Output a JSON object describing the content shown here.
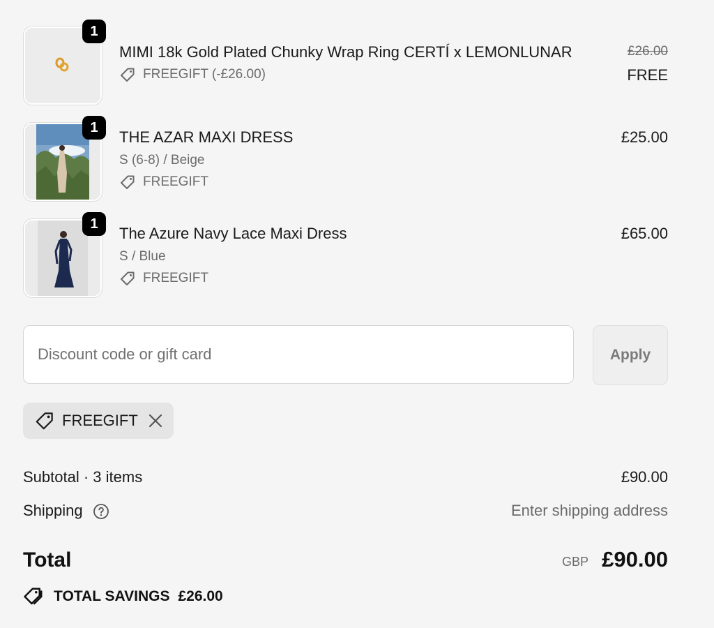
{
  "items": [
    {
      "quantity": "1",
      "title": "MIMI 18k Gold Plated Chunky Wrap Ring CERTÍ x LEMONLUNAR",
      "discount": "FREEGIFT (-£26.00)",
      "original_price": "£26.00",
      "price": "FREE"
    },
    {
      "quantity": "1",
      "title": "THE AZAR MAXI DRESS",
      "variant": "S (6-8) / Beige",
      "discount": "FREEGIFT",
      "price": "£25.00"
    },
    {
      "quantity": "1",
      "title": "The Azure Navy Lace Maxi Dress",
      "variant": "S / Blue",
      "discount": "FREEGIFT",
      "price": "£65.00"
    }
  ],
  "discount_form": {
    "placeholder": "Discount code or gift card",
    "value": "",
    "apply_label": "Apply"
  },
  "applied_code": {
    "label": "FREEGIFT"
  },
  "summary": {
    "subtotal_label": "Subtotal · 3 items",
    "subtotal_value": "£90.00",
    "shipping_label": "Shipping",
    "shipping_value": "Enter shipping address",
    "total_label": "Total",
    "currency": "GBP",
    "total_value": "£90.00",
    "savings_label": "TOTAL SAVINGS",
    "savings_value": "£26.00"
  },
  "icons": {
    "tag": "tag-icon",
    "remove": "close-icon",
    "help": "question-circle-icon",
    "savings": "tags-icon"
  },
  "colors": {
    "background": "#f5f5f5",
    "badge": "#000000",
    "muted_text": "#6b6b6b",
    "chip_bg": "#e5e5e5"
  }
}
